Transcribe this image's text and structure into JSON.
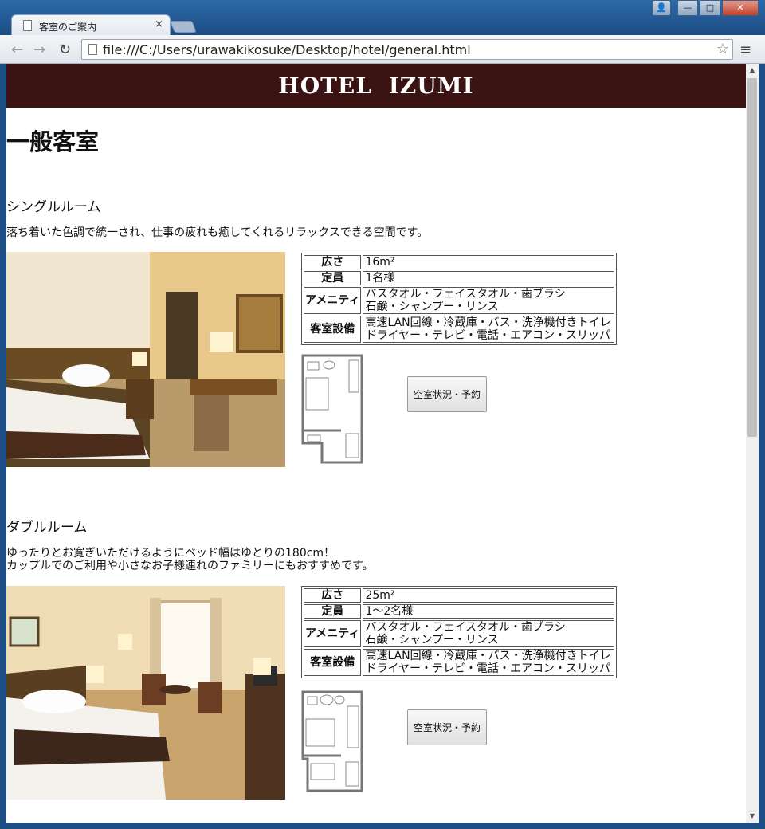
{
  "browser": {
    "tab_title": "客室のご案内",
    "tab_close": "×",
    "url": "file:///C:/Users/urawakikosuke/Desktop/hotel/general.html"
  },
  "page": {
    "hotel_name": "HOTEL IZUMI",
    "title": "一般客室",
    "reserve_label": "空室状況・予約",
    "labels": {
      "area": "広さ",
      "capacity": "定員",
      "amenities": "アメニティ",
      "facilities": "客室設備"
    },
    "rooms": [
      {
        "name": "シングルルーム",
        "description": [
          "落ち着いた色調で統一され、仕事の疲れも癒してくれるリラックスできる空間です。"
        ],
        "area": "16m²",
        "capacity": "1名様",
        "amenities": [
          "バスタオル・フェイスタオル・歯ブラシ",
          "石鹸・シャンプー・リンス"
        ],
        "facilities": [
          "高速LAN回線・冷蔵庫・バス・洗浄機付きトイレ",
          "ドライヤー・テレビ・電話・エアコン・スリッパ"
        ]
      },
      {
        "name": "ダブルルーム",
        "description": [
          "ゆったりとお寛ぎいただけるようにベッド幅はゆとりの180cm！",
          "カップルでのご利用や小さなお子様連れのファミリーにもおすすめです。"
        ],
        "area": "25m²",
        "capacity": "1〜2名様",
        "amenities": [
          "バスタオル・フェイスタオル・歯ブラシ",
          "石鹸・シャンプー・リンス"
        ],
        "facilities": [
          "高速LAN回線・冷蔵庫・バス・洗浄機付きトイレ",
          "ドライヤー・テレビ・電話・エアコン・スリッパ"
        ]
      }
    ]
  },
  "colors": {
    "header_bg": "#3b1313",
    "header_text": "#ffffff"
  }
}
